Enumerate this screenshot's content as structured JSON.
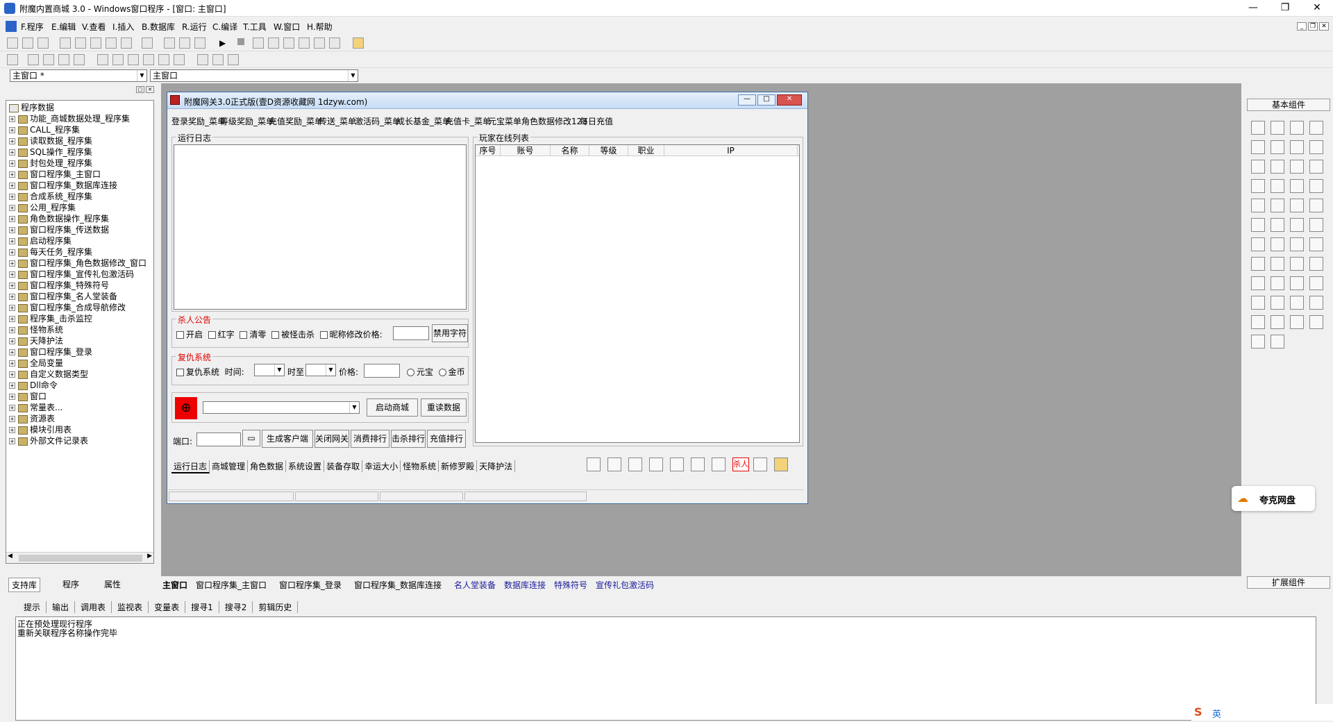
{
  "window": {
    "title": "附魔内置商城 3.0 - Windows窗口程序 - [窗口: 主窗口]"
  },
  "menubar": [
    "F.程序",
    "E.编辑",
    "V.查看",
    "I.插入",
    "B.数据库",
    "R.运行",
    "C.编译",
    "T.工具",
    "W.窗口",
    "H.帮助"
  ],
  "combos": {
    "left": "主窗口 *",
    "right": "主窗口"
  },
  "tree": {
    "root": "程序数据",
    "items": [
      "功能_商城数据处理_程序集",
      "CALL_程序集",
      "读取数据_程序集",
      "SQL操作_程序集",
      "封包处理_程序集",
      "窗口程序集_主窗口",
      "窗口程序集_数据库连接",
      "合成系统_程序集",
      "公用_程序集",
      "角色数据操作_程序集",
      "窗口程序集_传送数据",
      "启动程序集",
      "每天任务_程序集",
      "窗口程序集_角色数据修改_窗口",
      "窗口程序集_宣传礼包激活码",
      "窗口程序集_特殊符号",
      "窗口程序集_名人堂装备",
      "窗口程序集_合成导航修改",
      "程序集_击杀监控",
      "怪物系统",
      "天降护法",
      "窗口程序集_登录",
      "全局变量",
      "自定义数据类型",
      "Dll命令",
      "窗口",
      "常量表...",
      "资源表",
      "模块引用表",
      "外部文件记录表"
    ]
  },
  "left_tabs": [
    "支持库",
    "程序",
    "属性"
  ],
  "form": {
    "title": "附魔网关3.0正式版(壹D资源收藏网 1dzyw.com)",
    "menus": [
      "登录奖励_菜单",
      "等级奖励_菜单",
      "充值奖励_菜单",
      "传送_菜单",
      "激活码_菜单",
      "成长基金_菜单",
      "充值卡_菜单",
      "元宝菜单",
      "角色数据修改123",
      "每日充值"
    ],
    "log_label": "运行日志",
    "players_label": "玩家在线列表",
    "columns": [
      "序号",
      "账号",
      "名称",
      "等级",
      "职业",
      "IP"
    ],
    "kill": {
      "label": "杀人公告",
      "opts": [
        "开启",
        "红字",
        "清零",
        "被怪击杀",
        "昵称修改价格:"
      ],
      "button": "禁用字符"
    },
    "revenge": {
      "label": "复仇系统",
      "opts": [
        "复仇系统",
        "时间:",
        "时至",
        "价格:"
      ],
      "radio": [
        "元宝",
        "金币"
      ]
    },
    "start_btn": "启动商城",
    "reload_btn": "重读数据",
    "port_label": "端口:",
    "buttons": [
      "生成客户端",
      "关闭网关",
      "消费排行",
      "击杀排行",
      "充值排行"
    ],
    "tabs": [
      "运行日志",
      "商城管理",
      "角色数据",
      "系统设置",
      "装备存取",
      "幸运大小",
      "怪物系统",
      "新修罗殿",
      "天降护法"
    ],
    "kill_icon_text": "杀人"
  },
  "doc_tabs": [
    "主窗口",
    "窗口程序集_主窗口",
    "窗口程序集_登录",
    "窗口程序集_数据库连接",
    "名人堂装备",
    "数据库连接",
    "特殊符号",
    "宣传礼包激活码"
  ],
  "right_panel": {
    "header": "基本组件",
    "footer": "扩展组件"
  },
  "bottom_tabs": [
    "提示",
    "输出",
    "调用表",
    "监视表",
    "变量表",
    "搜寻1",
    "搜寻2",
    "剪辑历史"
  ],
  "output_lines": [
    "正在预处理现行程序",
    "重新关联程序名称操作完毕"
  ],
  "floating": {
    "label": "夸克网盘"
  },
  "ime": {
    "label": "英"
  }
}
